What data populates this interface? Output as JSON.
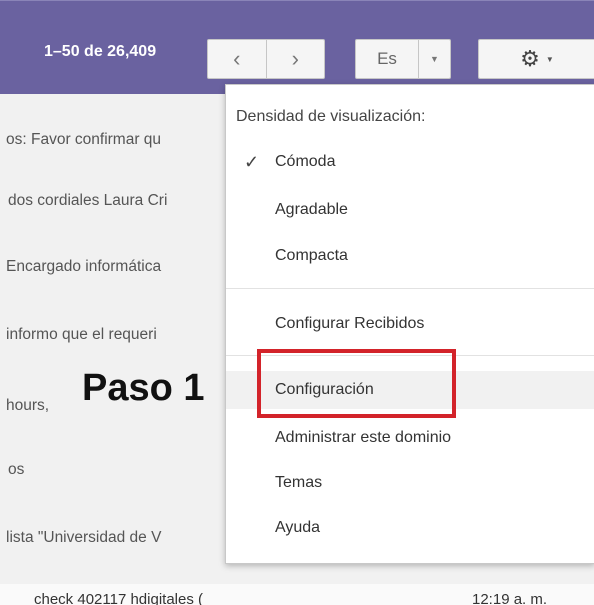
{
  "toolbar": {
    "count_label": "1–50 de 26,409",
    "prev_icon": "chevron-left",
    "next_icon": "chevron-right",
    "language_code": "Es",
    "settings_icon": "gear"
  },
  "email_rows": [
    "os: Favor confirmar qu",
    "dos cordiales Laura Cri",
    "Encargado informática",
    "informo que el requeri",
    "hours,",
    "os",
    "lista \"Universidad de V"
  ],
  "bottom_row": {
    "subject": "check 402117 hdigitales (",
    "time": "12:19 a. m."
  },
  "annotation": {
    "step_label": "Paso 1"
  },
  "settings_menu": {
    "density_header": "Densidad de visualización:",
    "density_options": [
      {
        "label": "Cómoda",
        "selected": true
      },
      {
        "label": "Agradable",
        "selected": false
      },
      {
        "label": "Compacta",
        "selected": false
      }
    ],
    "configure_inbox": "Configurar Recibidos",
    "items": [
      {
        "label": "Configuración",
        "highlighted": true
      },
      {
        "label": "Administrar este dominio",
        "highlighted": false
      },
      {
        "label": "Temas",
        "highlighted": false
      },
      {
        "label": "Ayuda",
        "highlighted": false
      }
    ]
  },
  "colors": {
    "topbar": "#6a62a0",
    "highlight_box": "#d3232a"
  }
}
